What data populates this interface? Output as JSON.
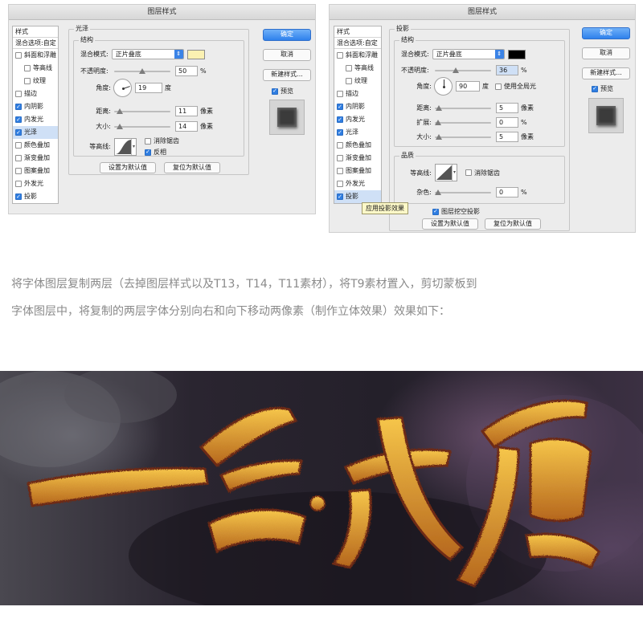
{
  "left_dialog": {
    "title": "图层样式",
    "styles_header": "样式",
    "blend_options": "混合选项:自定",
    "style_items": [
      {
        "label": "斜面和浮雕",
        "checked": false,
        "sub": false,
        "selected": false
      },
      {
        "label": "等高线",
        "checked": false,
        "sub": true,
        "selected": false
      },
      {
        "label": "纹理",
        "checked": false,
        "sub": true,
        "selected": false
      },
      {
        "label": "描边",
        "checked": false,
        "sub": false,
        "selected": false
      },
      {
        "label": "内阴影",
        "checked": true,
        "sub": false,
        "selected": false
      },
      {
        "label": "内发光",
        "checked": true,
        "sub": false,
        "selected": false
      },
      {
        "label": "光泽",
        "checked": true,
        "sub": false,
        "selected": true
      },
      {
        "label": "颜色叠加",
        "checked": false,
        "sub": false,
        "selected": false
      },
      {
        "label": "渐变叠加",
        "checked": false,
        "sub": false,
        "selected": false
      },
      {
        "label": "图案叠加",
        "checked": false,
        "sub": false,
        "selected": false
      },
      {
        "label": "外发光",
        "checked": false,
        "sub": false,
        "selected": false
      },
      {
        "label": "投影",
        "checked": true,
        "sub": false,
        "selected": false
      }
    ],
    "section_title": "光泽",
    "structure_title": "结构",
    "blend_mode_label": "混合模式:",
    "blend_mode_value": "正片叠底",
    "swatch_color": "#fbf1b2",
    "opacity_label": "不透明度:",
    "opacity_value": "50",
    "opacity_unit": "%",
    "opacity_level": 0.5,
    "angle_label": "角度:",
    "angle_value": "19",
    "angle_unit": "度",
    "distance_label": "距离:",
    "distance_value": "11",
    "distance_unit": "像素",
    "size_label": "大小:",
    "size_value": "14",
    "size_unit": "像素",
    "contour_label": "等高线:",
    "antialias_label": "消除锯齿",
    "antialias_checked": false,
    "invert_label": "反相",
    "invert_checked": true,
    "set_default": "设置为默认值",
    "reset_default": "复位为默认值",
    "ok": "确定",
    "cancel": "取消",
    "new_style": "新建样式...",
    "preview_label": "预览",
    "preview_checked": true
  },
  "right_dialog": {
    "title": "图层样式",
    "styles_header": "样式",
    "blend_options": "混合选项:自定",
    "style_items": [
      {
        "label": "斜面和浮雕",
        "checked": false,
        "sub": false,
        "selected": false
      },
      {
        "label": "等高线",
        "checked": false,
        "sub": true,
        "selected": false
      },
      {
        "label": "纹理",
        "checked": false,
        "sub": true,
        "selected": false
      },
      {
        "label": "描边",
        "checked": false,
        "sub": false,
        "selected": false
      },
      {
        "label": "内阴影",
        "checked": true,
        "sub": false,
        "selected": false
      },
      {
        "label": "内发光",
        "checked": true,
        "sub": false,
        "selected": false
      },
      {
        "label": "光泽",
        "checked": true,
        "sub": false,
        "selected": false
      },
      {
        "label": "颜色叠加",
        "checked": false,
        "sub": false,
        "selected": false
      },
      {
        "label": "渐变叠加",
        "checked": false,
        "sub": false,
        "selected": false
      },
      {
        "label": "图案叠加",
        "checked": false,
        "sub": false,
        "selected": false
      },
      {
        "label": "外发光",
        "checked": false,
        "sub": false,
        "selected": false
      },
      {
        "label": "投影",
        "checked": true,
        "sub": false,
        "selected": true
      }
    ],
    "section_title": "投影",
    "structure_title": "结构",
    "blend_mode_label": "混合模式:",
    "blend_mode_value": "正片叠底",
    "swatch_color": "#000000",
    "opacity_label": "不透明度:",
    "opacity_value": "36",
    "opacity_unit": "%",
    "opacity_level": 0.36,
    "angle_label": "角度:",
    "angle_value": "90",
    "angle_unit": "度",
    "global_light_label": "使用全局光",
    "global_light_checked": false,
    "distance_label": "距离:",
    "distance_value": "5",
    "distance_unit": "像素",
    "spread_label": "扩展:",
    "spread_value": "0",
    "spread_unit": "%",
    "size_label": "大小:",
    "size_value": "5",
    "size_unit": "像素",
    "quality_title": "品质",
    "contour_label": "等高线:",
    "antialias_label": "消除锯齿",
    "antialias_checked": false,
    "noise_label": "杂色:",
    "noise_value": "0",
    "noise_unit": "%",
    "knockout_label": "图层挖空投影",
    "knockout_checked": true,
    "set_default": "设置为默认值",
    "reset_default": "复位为默认值",
    "tooltip": "应用投影效果",
    "ok": "确定",
    "cancel": "取消",
    "new_style": "新建样式...",
    "preview_label": "预览",
    "preview_checked": true
  },
  "paragraph": {
    "line1": "将字体图层复制两层（去掉图层样式以及T13，T14，T11素材），将T9素材置入，剪切蒙板到",
    "line2": "字体图层中，将复制的两层字体分别向右和向下移动两像素（制作立体效果）效果如下："
  },
  "banner": {
    "text_chars": [
      "一",
      "念",
      "成",
      "魔"
    ],
    "gold_light": "#f6c64a",
    "gold_dark": "#b5661d",
    "shadow": "#6e2b12"
  }
}
